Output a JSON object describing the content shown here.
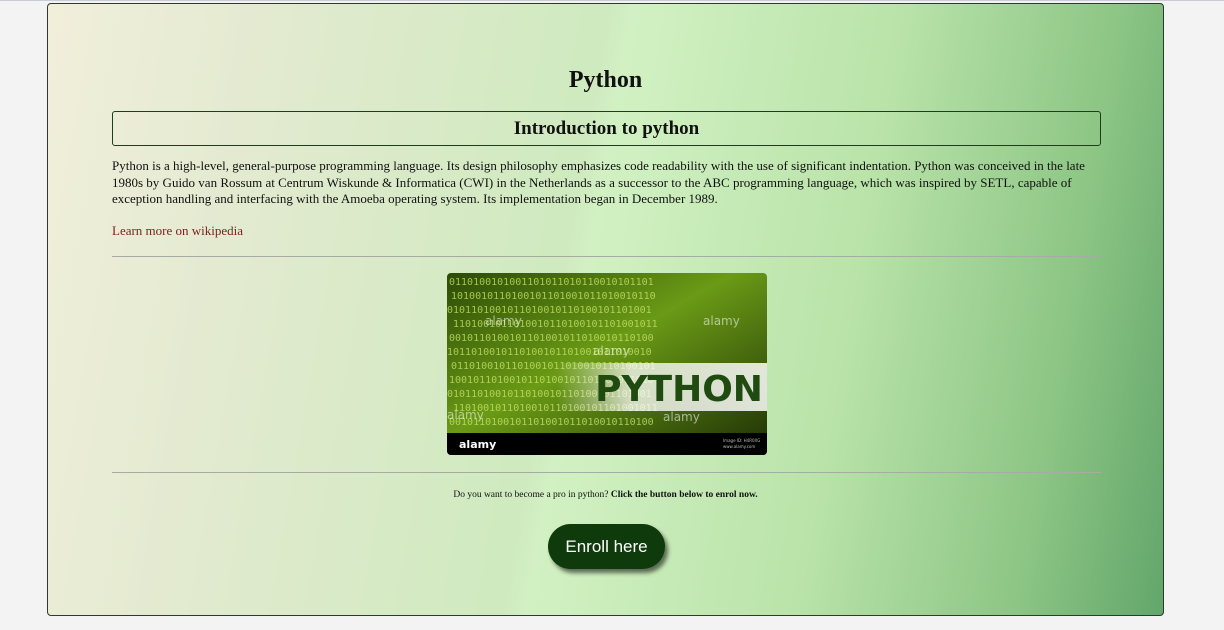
{
  "page": {
    "title": "Python"
  },
  "section": {
    "heading": "Introduction to python",
    "paragraph": "Python is a high-level, general-purpose programming language. Its design philosophy emphasizes code readability with the use of significant indentation. Python was conceived in the late 1980s by Guido van Rossum at Centrum Wiskunde & Informatica (CWI) in the Netherlands as a successor to the ABC programming language, which was inspired by SETL, capable of exception handling and interfacing with the Amoeba operating system. Its implementation began in December 1989.",
    "link_label": "Learn more on wikipedia"
  },
  "image": {
    "banner_word": "PYTHON",
    "watermark": "alamy",
    "footer_brand": "alamy",
    "footer_small_1": "Image ID: H4R0XG",
    "footer_small_2": "www.alamy.com"
  },
  "enrol": {
    "question": "Do you want to become a pro in python?",
    "cta_text": "Click the button below to enrol now.",
    "button_label": "Enroll here"
  },
  "colors": {
    "button": "#0f3a0c",
    "link": "#7a1f1f",
    "gradient_start": "#f1efdb",
    "gradient_end": "#63a66b"
  }
}
